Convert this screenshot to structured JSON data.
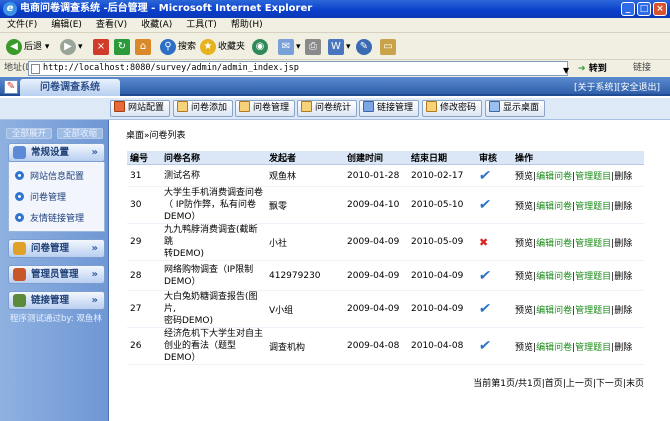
{
  "window": {
    "title": "电商问卷调查系统 -后台管理 - Microsoft Internet Explorer",
    "menus": [
      "文件(F)",
      "编辑(E)",
      "查看(V)",
      "收藏(A)",
      "工具(T)",
      "帮助(H)"
    ]
  },
  "toolbar": {
    "back": "后退",
    "search": "搜索",
    "favorites": "收藏夹"
  },
  "address": {
    "label": "地址(D)",
    "url": "http://localhost:8080/survey/admin/admin_index.jsp",
    "go": "转到",
    "links": "链接"
  },
  "app": {
    "title": "问卷调查系统",
    "about": "[关于系统]",
    "logout": "[安全退出]"
  },
  "nav": [
    "网站配置",
    "问卷添加",
    "问卷管理",
    "问卷统计",
    "链接管理",
    "修改密码",
    "显示桌面"
  ],
  "sidebar": {
    "expand_all": "全部展开",
    "collapse_all": "全部收缩",
    "groups": [
      "常规设置",
      "问卷管理",
      "管理员管理",
      "链接管理"
    ],
    "items": [
      "网站信息配置",
      "问卷管理",
      "友情链接管理"
    ],
    "footer": "程序测试通过by: 观鱼林"
  },
  "breadcrumb": "桌面»问卷列表",
  "table": {
    "headers": [
      "编号",
      "问卷名称",
      "发起者",
      "创建时间",
      "结束日期",
      "审核",
      "操作"
    ],
    "rows": [
      {
        "id": "31",
        "name": [
          "测试名称"
        ],
        "sponsor": "观鱼林",
        "created": "2010-01-28",
        "end": "2010-02-17",
        "approved": true
      },
      {
        "id": "30",
        "name": [
          "大学生手机消费调查问卷",
          "（ IP防作弊，私有问卷",
          "DEMO）"
        ],
        "sponsor": "飘零",
        "created": "2009-04-10",
        "end": "2010-05-10",
        "approved": true
      },
      {
        "id": "29",
        "name": [
          "九九鸭脖消费调查(截断跳",
          "转DEMO)"
        ],
        "sponsor": "小社",
        "created": "2009-04-09",
        "end": "2010-05-09",
        "approved": false
      },
      {
        "id": "28",
        "name": [
          "网络购物调查（IP限制",
          "DEMO）"
        ],
        "sponsor": "412979230",
        "created": "2009-04-09",
        "end": "2010-04-09",
        "approved": true
      },
      {
        "id": "27",
        "name": [
          "大白兔奶糖调查报告(图片,",
          "密码DEMO)"
        ],
        "sponsor": "V小组",
        "created": "2009-04-09",
        "end": "2010-04-09",
        "approved": true
      },
      {
        "id": "26",
        "name": [
          "经济危机下大学生对自主",
          "创业的看法（题型",
          "DEMO）"
        ],
        "sponsor": "调查机构",
        "created": "2009-04-08",
        "end": "2010-04-08",
        "approved": true
      }
    ],
    "actions": {
      "preview": "预览",
      "edit": "编辑问卷",
      "manage": "管理题目",
      "delete": "删除"
    }
  },
  "pager": "当前第1页/共1页|首页|上一页|下一页|末页"
}
